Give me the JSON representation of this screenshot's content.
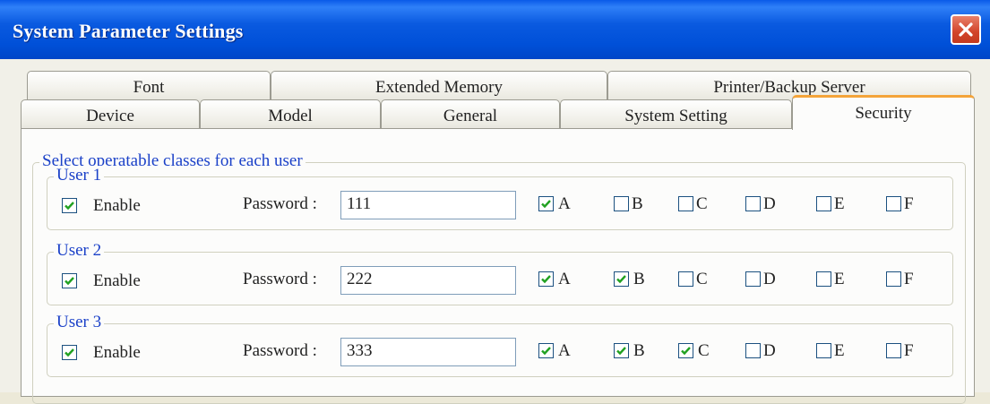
{
  "window": {
    "title": "System Parameter Settings"
  },
  "tabs_row1": [
    {
      "label": "Font"
    },
    {
      "label": "Extended Memory"
    },
    {
      "label": "Printer/Backup Server"
    }
  ],
  "tabs_row2": [
    {
      "label": "Device"
    },
    {
      "label": "Model"
    },
    {
      "label": "General"
    },
    {
      "label": "System Setting"
    },
    {
      "label": "Security",
      "active": true
    }
  ],
  "security": {
    "group_title": "Select operatable classes for each user",
    "enable_label": "Enable",
    "password_label": "Password :",
    "class_labels": [
      "A",
      "B",
      "C",
      "D",
      "E",
      "F"
    ],
    "users": [
      {
        "title": "User 1",
        "enabled": true,
        "password": "111",
        "classes": [
          true,
          false,
          false,
          false,
          false,
          false
        ]
      },
      {
        "title": "User 2",
        "enabled": true,
        "password": "222",
        "classes": [
          true,
          true,
          false,
          false,
          false,
          false
        ]
      },
      {
        "title": "User 3",
        "enabled": true,
        "password": "333",
        "classes": [
          true,
          true,
          true,
          false,
          false,
          false
        ]
      }
    ]
  },
  "icons": {
    "close": "close-icon",
    "check": "checkmark-icon"
  },
  "colors": {
    "title_bar": "#0054e3",
    "active_tab_accent": "#f4a43a",
    "group_title": "#1a40c8",
    "close_button": "#d2442a"
  }
}
